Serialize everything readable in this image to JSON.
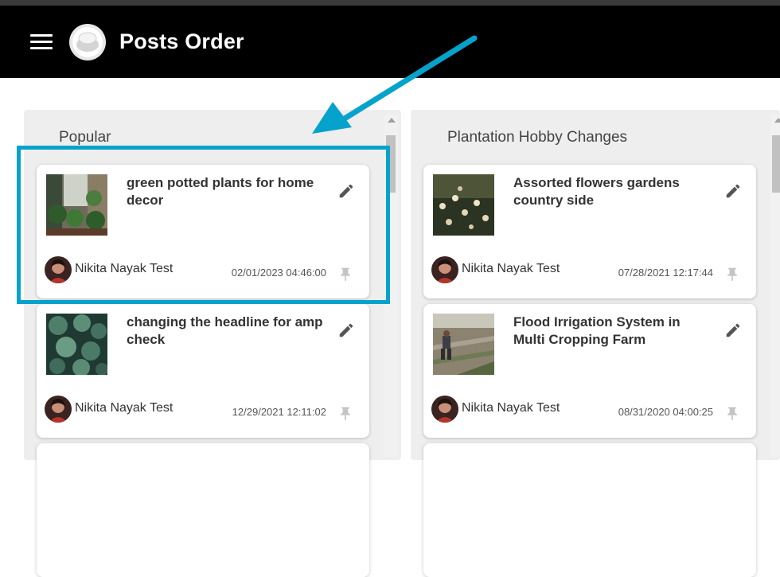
{
  "app": {
    "title": "Posts Order"
  },
  "columns": [
    {
      "title": "Popular",
      "cards": [
        {
          "title": "green potted plants for home decor",
          "author": "Nikita Nayak Test",
          "date": "02/01/2023 04:46:00",
          "thumb": "plants-shelf"
        },
        {
          "title": "changing the headline for amp check",
          "author": "Nikita Nayak Test",
          "date": "12/29/2021 12:11:02",
          "thumb": "succulents"
        }
      ]
    },
    {
      "title": "Plantation Hobby Changes",
      "cards": [
        {
          "title": "Assorted flowers gardens country side",
          "author": "Nikita Nayak Test",
          "date": "07/28/2021 12:17:44",
          "thumb": "flowers"
        },
        {
          "title": "Flood Irrigation System in Multi Cropping Farm",
          "author": "Nikita Nayak Test",
          "date": "08/31/2020 04:00:25",
          "thumb": "farm"
        }
      ]
    }
  ],
  "colors": {
    "appbar": "#000000",
    "highlight": "#05a3cc",
    "column_bg": "#eeeeee"
  },
  "icons": {
    "menu": "menu-icon",
    "edit": "pencil-icon",
    "pin": "pin-icon"
  }
}
